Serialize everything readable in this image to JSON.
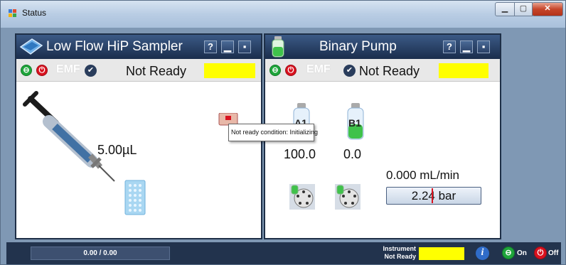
{
  "window": {
    "title": "Status"
  },
  "sampler": {
    "title": "Low Flow HiP Sampler",
    "help": "?",
    "emf": "EMF",
    "ready_status": "Not Ready",
    "volume": "5.00µL"
  },
  "pump": {
    "title": "Binary Pump",
    "help": "?",
    "emf": "EMF",
    "ready_status": "Not Ready",
    "solvents": [
      {
        "name": "A1",
        "percent": "100.0"
      },
      {
        "name": "B1",
        "percent": "0.0"
      }
    ],
    "flow": "0.000 mL/min",
    "pressure": "2.24 bar"
  },
  "tooltip": "Not ready condition: Initializing",
  "bottom": {
    "progress": "0.00 / 0.00",
    "instrument_line1": "Instrument",
    "instrument_line2": "Not Ready",
    "on_label": "On",
    "off_label": "Off"
  },
  "colors": {
    "status_yellow": "#ffff00",
    "panel_header": "#1a2d4c",
    "background": "#7f98b4",
    "on_green": "#1fa53b",
    "off_red": "#d9121f"
  },
  "icons": [
    "status-window-icon",
    "sampler-tray-icon",
    "syringe-icon",
    "vial-plate-icon",
    "sample-vial-icon",
    "solvent-bottle-icon",
    "purge-valve-icon",
    "info-icon",
    "on-icon",
    "off-icon",
    "check-icon"
  ]
}
